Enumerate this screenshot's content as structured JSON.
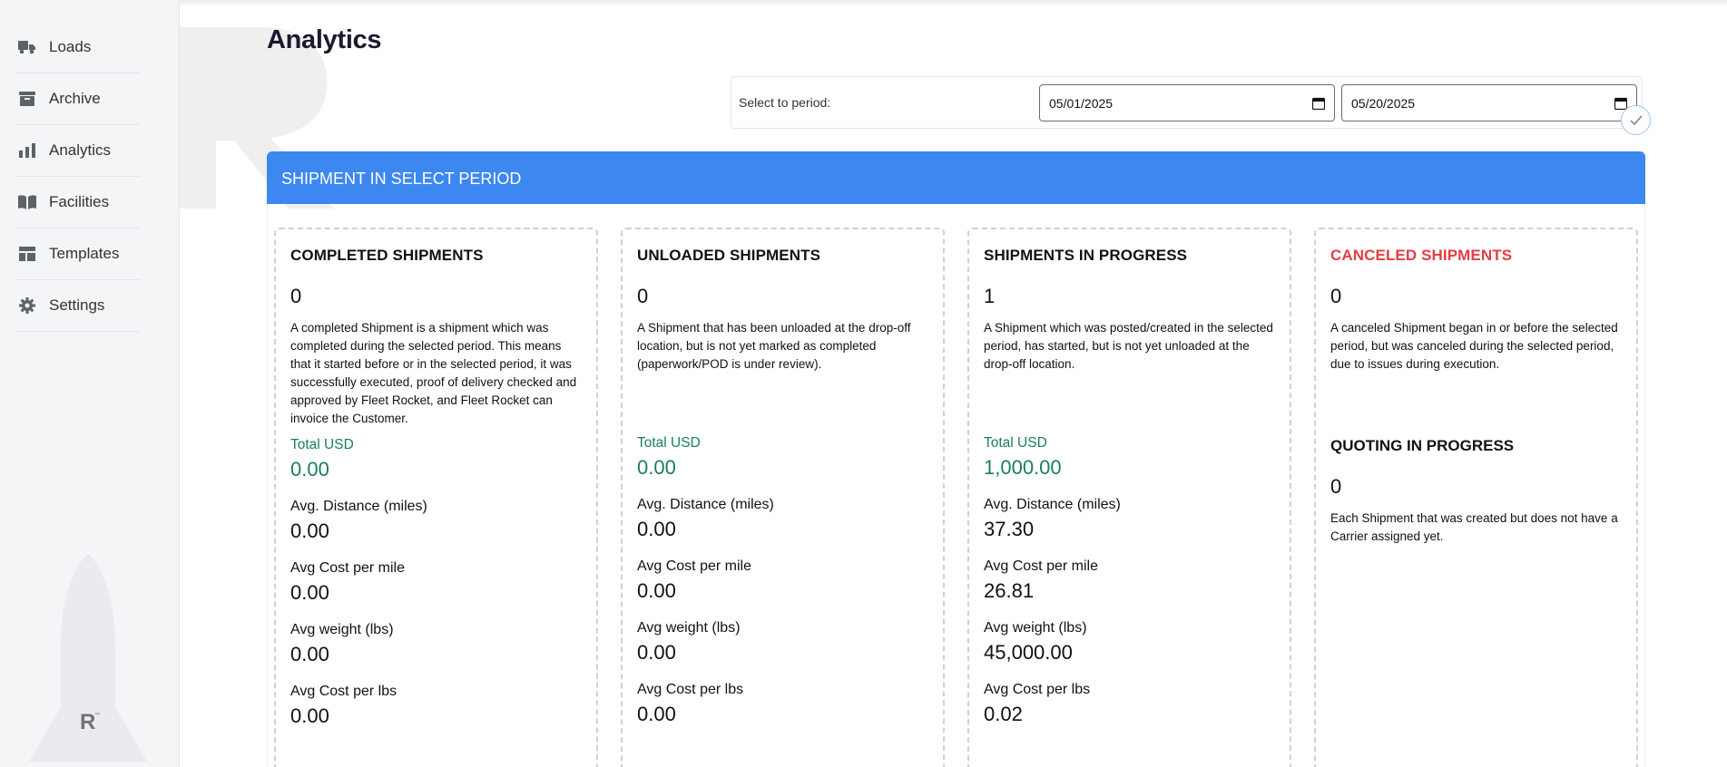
{
  "sidebar": {
    "items": [
      {
        "label": "Loads",
        "icon": "truck-icon"
      },
      {
        "label": "Archive",
        "icon": "archive-icon"
      },
      {
        "label": "Analytics",
        "icon": "bar-chart-icon"
      },
      {
        "label": "Facilities",
        "icon": "book-open-icon"
      },
      {
        "label": "Templates",
        "icon": "template-icon"
      },
      {
        "label": "Settings",
        "icon": "gear-icon"
      }
    ]
  },
  "page": {
    "title": "Analytics"
  },
  "period": {
    "label": "Select to period:",
    "from": "05/01/2025",
    "to": "05/20/2025"
  },
  "section": {
    "title": "SHIPMENT IN SELECT PERIOD"
  },
  "stat_labels": {
    "total": "Total USD",
    "avg_distance": "Avg. Distance (miles)",
    "avg_cost_mile": "Avg Cost per mile",
    "avg_weight": "Avg weight (lbs)",
    "avg_cost_lbs": "Avg Cost per lbs"
  },
  "cards": [
    {
      "title": "COMPLETED SHIPMENTS",
      "count": "0",
      "description": "A completed Shipment is a shipment which was completed during the selected period. This means that it started before or in the selected period, it was successfully executed, proof of delivery checked and approved by Fleet Rocket, and Fleet Rocket can invoice the Customer.",
      "total": "0.00",
      "avg_distance": "0.00",
      "avg_cost_mile": "0.00",
      "avg_weight": "0.00",
      "avg_cost_lbs": "0.00"
    },
    {
      "title": "UNLOADED SHIPMENTS",
      "count": "0",
      "description": "A Shipment that has been unloaded at the drop-off location, but is not yet marked as completed (paperwork/POD is under review).",
      "total": "0.00",
      "avg_distance": "0.00",
      "avg_cost_mile": "0.00",
      "avg_weight": "0.00",
      "avg_cost_lbs": "0.00"
    },
    {
      "title": "SHIPMENTS IN PROGRESS",
      "count": "1",
      "description": "A Shipment which was posted/created in the selected period, has started, but is not yet unloaded at the drop-off location.",
      "total": "1,000.00",
      "avg_distance": "37.30",
      "avg_cost_mile": "26.81",
      "avg_weight": "45,000.00",
      "avg_cost_lbs": "0.02"
    },
    {
      "title": "CANCELED SHIPMENTS",
      "count": "0",
      "description": "A canceled Shipment began in or before the selected period, but was canceled during the selected period, due to issues during execution."
    }
  ],
  "quoting": {
    "title": "QUOTING IN PROGRESS",
    "count": "0",
    "description": "Each Shipment that was created but does not have a Carrier assigned yet."
  },
  "colors": {
    "accent": "#3d87f0",
    "money": "#1a7f5a",
    "canceled": "#e53d45"
  }
}
